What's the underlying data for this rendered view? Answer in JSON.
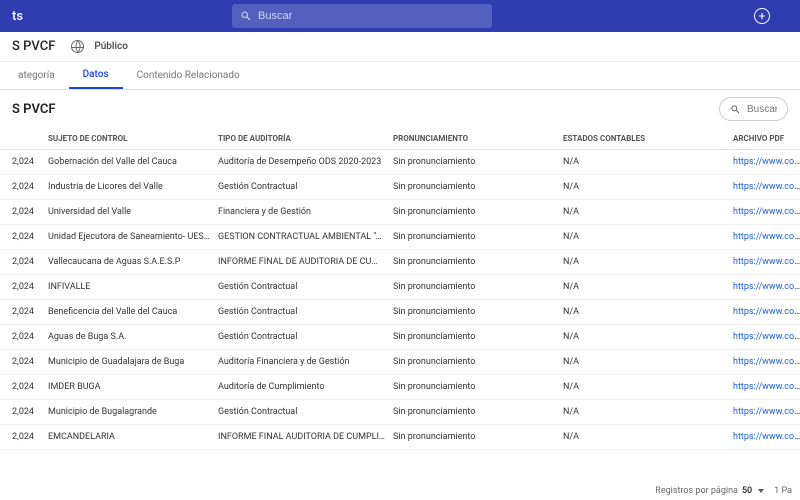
{
  "topbar": {
    "brand_fragment": "ts",
    "search_placeholder": "Buscar"
  },
  "header": {
    "title_fragment": "S PVCF",
    "visibility_label": "Público"
  },
  "tabs": {
    "category": "ategoría",
    "data": "Datos",
    "related": "Contenido Relacionado"
  },
  "subheader": {
    "title": "S PVCF",
    "search_placeholder": "Buscar"
  },
  "columns": {
    "year": "",
    "sujeto": "SUJETO DE CONTROL",
    "tipo": "TIPO DE AUDITORÍA",
    "pronunciamiento": "PRONUNCIAMIENTO",
    "estados": "ESTADOS CONTABLES",
    "pdf": "ARCHIVO PDF"
  },
  "rows": [
    {
      "year": "2,024",
      "sujeto": "Gobernación del Valle del Cauca",
      "tipo": "Auditoría de Desempeño ODS 2020-2023",
      "pron": "Sin pronunciamiento",
      "est": "N/A",
      "pdf": "https://www.contra"
    },
    {
      "year": "2,024",
      "sujeto": "Industria de Licores del Valle",
      "tipo": "Gestión Contractual",
      "pron": "Sin pronunciamiento",
      "est": "N/A",
      "pdf": "https://www.contra"
    },
    {
      "year": "2,024",
      "sujeto": "Universidad del Valle",
      "tipo": "Financiera y de Gestión",
      "pron": "Sin pronunciamiento",
      "est": "N/A",
      "pdf": "https://www.contra"
    },
    {
      "year": "2,024",
      "sujeto": "Unidad Ejecutora de Saneamiento- UESVALLE",
      "tipo": "GESTION CONTRACTUAL AMBIENTAL \"AGUA PAR/",
      "pron": "Sin pronunciamiento",
      "est": "N/A",
      "pdf": "https://www.contra"
    },
    {
      "year": "2,024",
      "sujeto": "Vallecaucana de Aguas S.A.E.S.P",
      "tipo": "INFORME FINAL DE AUDITORIA DE CUMPLIMIENT",
      "pron": "Sin pronunciamiento",
      "est": "N/A",
      "pdf": "https://www.contra"
    },
    {
      "year": "2,024",
      "sujeto": "INFIVALLE",
      "tipo": "Gestión Contractual",
      "pron": "Sin pronunciamiento",
      "est": "N/A",
      "pdf": "https://www.contra"
    },
    {
      "year": "2,024",
      "sujeto": "Beneficencia del Valle del Cauca",
      "tipo": "Gestión Contractual",
      "pron": "Sin pronunciamiento",
      "est": "N/A",
      "pdf": "https://www.contra"
    },
    {
      "year": "2,024",
      "sujeto": "Aguas de Buga S.A.",
      "tipo": "Gestión Contractual",
      "pron": "Sin pronunciamiento",
      "est": "N/A",
      "pdf": "https://www.contra"
    },
    {
      "year": "2,024",
      "sujeto": "Municipio de Guadalajara de Buga",
      "tipo": "Auditoría Financiera y de Gestión",
      "pron": "Sin pronunciamiento",
      "est": "N/A",
      "pdf": "https://www.contra"
    },
    {
      "year": "2,024",
      "sujeto": "IMDER BUGA",
      "tipo": "Auditoría de Cumplimiento",
      "pron": "Sin pronunciamiento",
      "est": "N/A",
      "pdf": "https://www.contra"
    },
    {
      "year": "2,024",
      "sujeto": "Municipio de Bugalagrande",
      "tipo": "Gestión Contractual",
      "pron": "Sin pronunciamiento",
      "est": "N/A",
      "pdf": "https://www.contra"
    },
    {
      "year": "2,024",
      "sujeto": "EMCANDELARIA",
      "tipo": "INFORME FINAL AUDITORIA DE CUMPLIMIENTO G",
      "pron": "Sin pronunciamiento",
      "est": "N/A",
      "pdf": "https://www.contra"
    }
  ],
  "footer": {
    "per_page_label": "Registros por página",
    "per_page_value": "50",
    "page_info": "1 Pa"
  }
}
